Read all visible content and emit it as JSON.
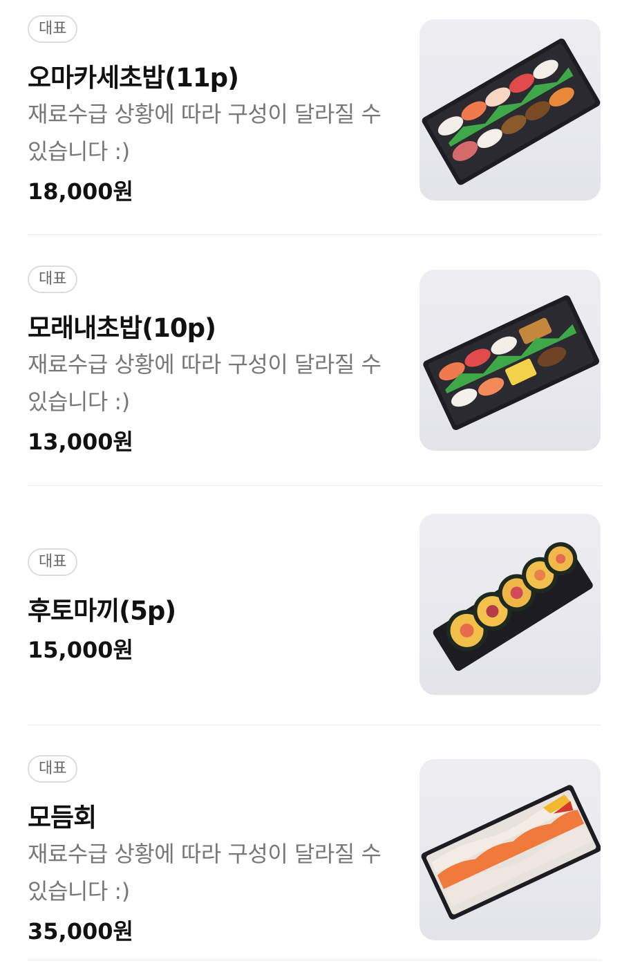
{
  "menu": [
    {
      "badge": "대표",
      "title": "오마카세초밥(11p)",
      "desc": "재료수급 상황에 따라 구성이 달라질 수 있습니다 :)",
      "price": "18,000원",
      "image_icon": "nigiri-sushi-tray-image"
    },
    {
      "badge": "대표",
      "title": "모래내초밥(10p)",
      "desc": "재료수급 상황에 따라 구성이 달라질 수 있습니다 :)",
      "price": "13,000원",
      "image_icon": "sushi-platter-tray-image"
    },
    {
      "badge": "대표",
      "title": "후토마끼(5p)",
      "price": "15,000원",
      "image_icon": "futomaki-roll-tray-image"
    },
    {
      "badge": "대표",
      "title": "모듬회",
      "desc": "재료수급 상황에 따라 구성이 달라질 수 있습니다 :)",
      "price": "35,000원",
      "image_icon": "sashimi-platter-tray-image"
    }
  ]
}
